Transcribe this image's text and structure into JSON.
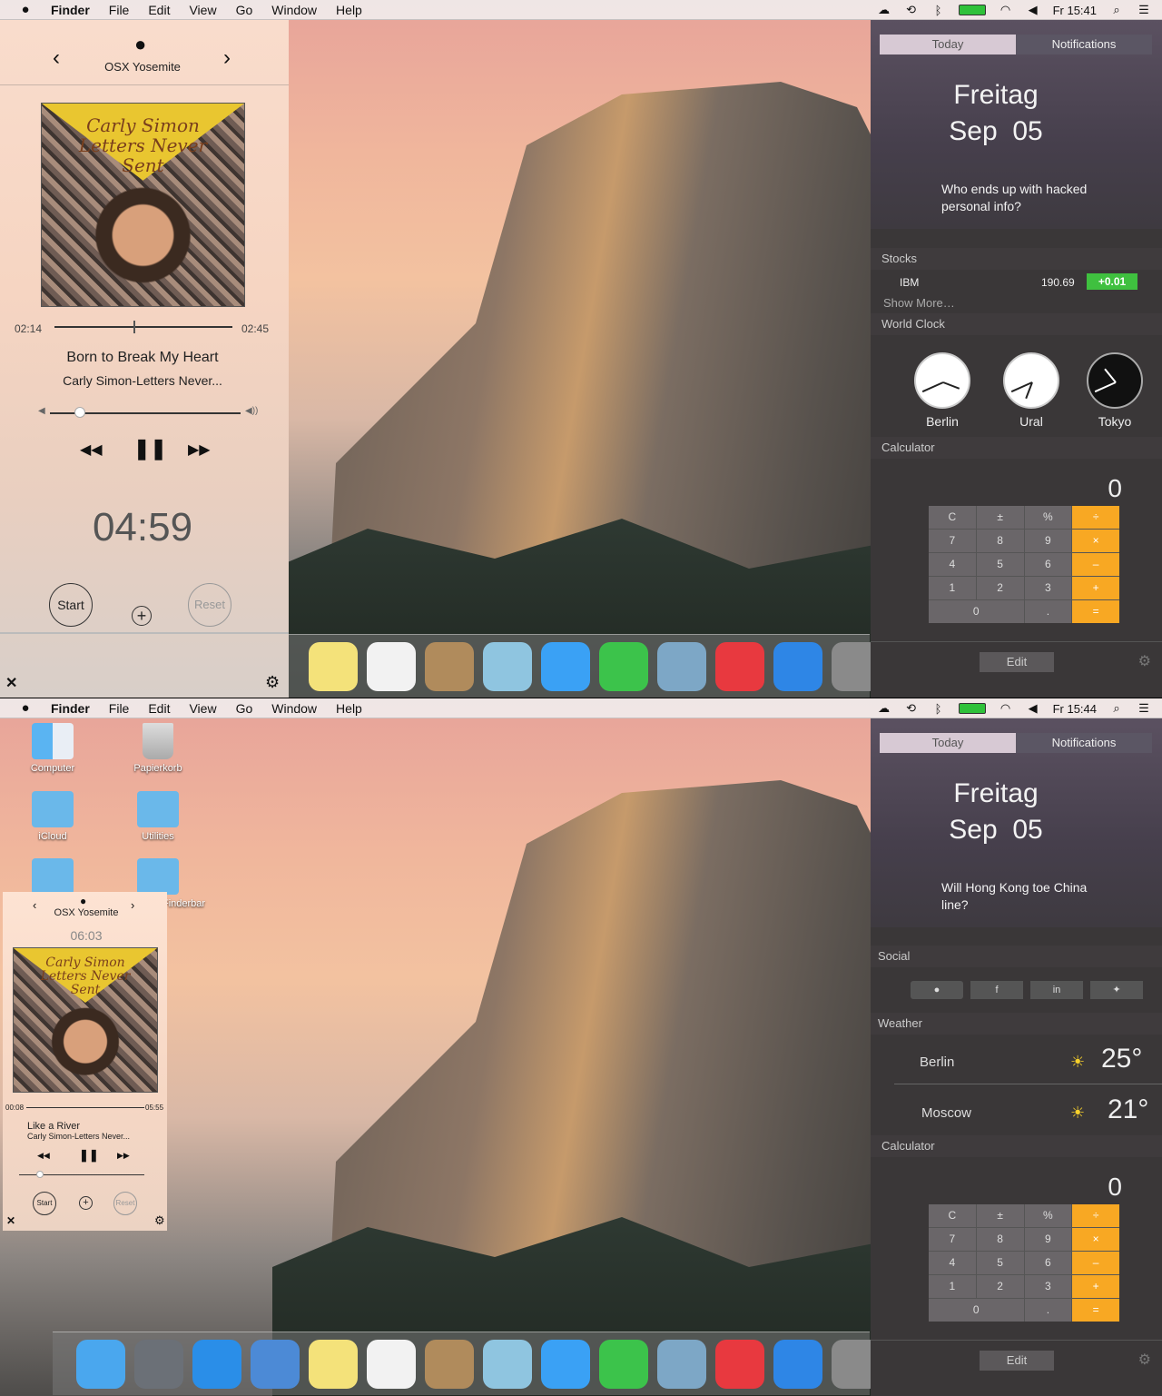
{
  "top": {
    "menubar": {
      "apple": "",
      "app": "Finder",
      "items": [
        "File",
        "Edit",
        "View",
        "Go",
        "Window",
        "Help"
      ],
      "clock": "Fr 15:41"
    },
    "player": {
      "title": "OSX Yosemite",
      "prev": "‹",
      "next": "›",
      "album_line1": "Carly Simon",
      "album_line2": "Letters Never",
      "album_line3": "Sent",
      "elapsed": "02:14",
      "duration": "02:45",
      "progress": 0.58,
      "song": "Born to Break My Heart",
      "artist": "Carly Simon-Letters Never...",
      "volume": 0.15,
      "timer": "04:59",
      "start": "Start",
      "add": "+",
      "reset": "Reset",
      "close": "✕",
      "settings": "⚙"
    },
    "nc": {
      "tab_today": "Today",
      "tab_notifications": "Notifications",
      "day": "Freitag",
      "date_month": "Sep",
      "date_day": "05",
      "question": "Who ends up with hacked personal info?",
      "stocks_title": "Stocks",
      "stock_symbol": "IBM",
      "stock_price": "190.69",
      "stock_change": "+0.01",
      "show_more": "Show More…",
      "world_clock_title": "World Clock",
      "clocks": [
        {
          "city": "Berlin",
          "hour": 3.7,
          "minute": 41
        },
        {
          "city": "Ural",
          "hour": 6.7,
          "minute": 41
        },
        {
          "city": "Tokyo",
          "hour": 10.7,
          "minute": 41
        }
      ],
      "calculator_title": "Calculator",
      "calc_display": "0",
      "edit": "Edit",
      "gear": "⚙"
    }
  },
  "bottom": {
    "menubar": {
      "apple": "",
      "app": "Finder",
      "items": [
        "File",
        "Edit",
        "View",
        "Go",
        "Window",
        "Help"
      ],
      "clock": "Fr 15:44"
    },
    "desktop": {
      "computer": "Computer",
      "trash": "Papierkorb",
      "icloud": "iCloud",
      "utilities": "Utilities",
      "finderbar": "Finderbar"
    },
    "player": {
      "title": "OSX Yosemite",
      "prev": "‹",
      "next": "›",
      "timer": "06:03",
      "album_line1": "Carly Simon",
      "album_line2": "Letters Never",
      "album_line3": "Sent",
      "elapsed": "00:08",
      "duration": "05:55",
      "progress": 0.02,
      "song": "Like a River",
      "artist": "Carly Simon-Letters Never...",
      "volume": 0.2,
      "start": "Start",
      "add": "+",
      "reset": "Reset",
      "close": "✕",
      "settings": "⚙"
    },
    "nc": {
      "tab_today": "Today",
      "tab_notifications": "Notifications",
      "day": "Freitag",
      "date_month": "Sep",
      "date_day": "05",
      "question": "Will Hong Kong toe China line?",
      "social_title": "Social",
      "weather_title": "Weather",
      "weather": [
        {
          "city": "Berlin",
          "temp": "25°"
        },
        {
          "city": "Moscow",
          "temp": "21°"
        }
      ],
      "calculator_title": "Calculator",
      "calc_display": "0",
      "edit": "Edit",
      "gear": "⚙"
    }
  },
  "calc_keys": [
    "C",
    "±",
    "%",
    "÷",
    "7",
    "8",
    "9",
    "×",
    "4",
    "5",
    "6",
    "–",
    "1",
    "2",
    "3",
    "+",
    "0",
    ".",
    "="
  ],
  "dock_top": [
    "Notes",
    "Reminders",
    "Contacts",
    "Maps",
    "Messages",
    "FaceTime",
    "Preview",
    "iTunes",
    "App Store",
    "System Preferences"
  ],
  "dock_bottom": [
    "Finder",
    "Launchpad",
    "Safari",
    "Mail",
    "Notes",
    "Reminders",
    "Contacts",
    "Maps",
    "Messages",
    "FaceTime",
    "Preview",
    "iTunes",
    "App Store",
    "System Preferences"
  ],
  "colors": {
    "accent_calc": "#f8a823",
    "stock_up": "#3fc03f",
    "battery": "#2fc13a"
  }
}
